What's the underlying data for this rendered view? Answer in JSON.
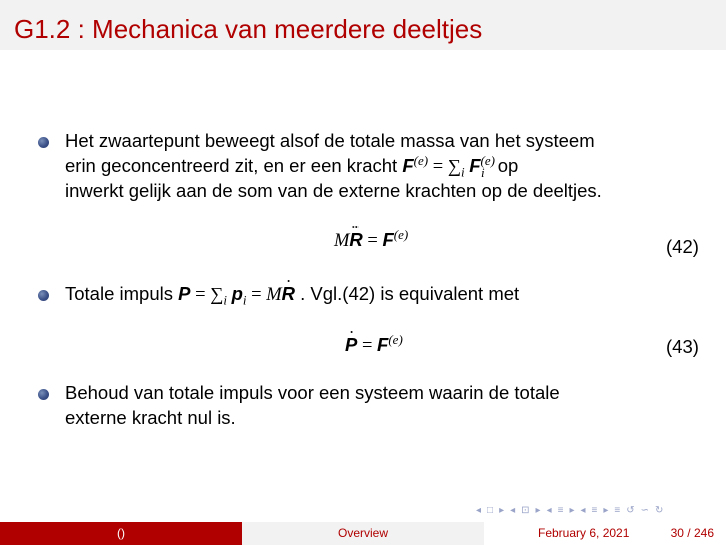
{
  "header": {
    "title": "G1.2 : Mechanica van meerdere deeltjes"
  },
  "bullets": [
    {
      "lines": [
        "Het zwaartepunt beweegt alsof de totale massa van het systeem",
        "erin geconcentreerd zit, en er een kracht",
        "op",
        "inwerkt gelijk aan de som van de externe krachten op de deeltjes."
      ]
    },
    {
      "pre": "Totale impuls",
      "post": ". Vgl.(42) is equivalent met"
    },
    {
      "lines": [
        "Behoud van totale impuls voor een systeem waarin de totale",
        "externe kracht nul is."
      ]
    }
  ],
  "equations": [
    {
      "number": "(42)"
    },
    {
      "number": "(43)"
    }
  ],
  "footer": {
    "author": "()",
    "section": "Overview",
    "date": "February 6, 2021",
    "page": "30 / 246"
  },
  "nav": {
    "symbols": [
      "◂",
      "□",
      "▸",
      "◂",
      "⊡",
      "▸",
      "◂",
      "≡",
      "▸",
      "◂",
      "≡",
      "▸",
      "≡",
      "↺",
      "∽",
      "↻"
    ]
  },
  "colors": {
    "title": "#b00000",
    "header_bg": "#f2f2f2",
    "bullet": "#3c5289",
    "footer_left": "#b00000"
  }
}
